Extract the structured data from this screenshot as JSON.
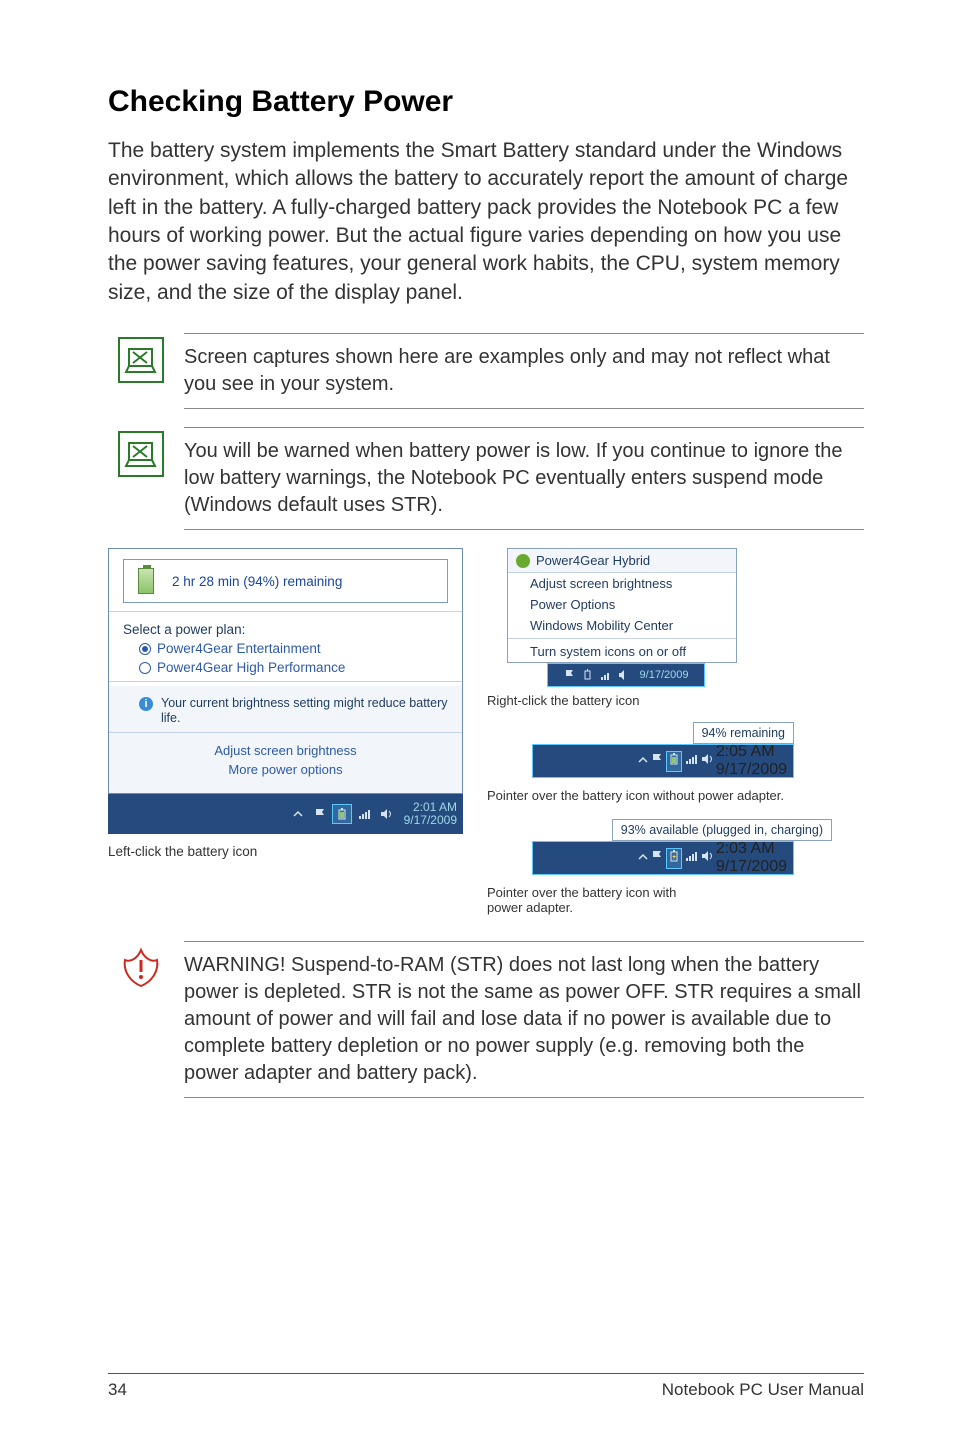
{
  "title": "Checking Battery Power",
  "intro": "The battery system implements the Smart Battery standard under the Windows environment, which allows the battery to accurately report the amount of charge left in the battery. A fully-charged battery pack provides the Notebook PC a few hours of working power. But the actual figure varies depending on how you use the power saving features, your general work habits, the CPU, system memory size, and the size of the display panel.",
  "note1": "Screen captures shown here are examples only and may not reflect what you see in your system.",
  "note2": "You will be warned when battery power is low. If you continue to ignore the low battery warnings, the Notebook PC eventually enters suspend mode (Windows default uses STR).",
  "left_panel": {
    "remaining": "2 hr 28 min (94%) remaining",
    "plan_header": "Select a power plan:",
    "plan1": "Power4Gear Entertainment",
    "plan2": "Power4Gear High Performance",
    "info": "Your current brightness setting might reduce battery life.",
    "link1": "Adjust screen brightness",
    "link2": "More power options",
    "clock_time": "2:01 AM",
    "clock_date": "9/17/2009",
    "caption": "Left-click the battery icon"
  },
  "right_panel": {
    "ctx_header": "Power4Gear Hybrid",
    "ctx_item1": "Adjust screen brightness",
    "ctx_item2": "Power Options",
    "ctx_item3": "Windows Mobility Center",
    "ctx_item4": "Turn system icons on or off",
    "ctx_date": "9/17/2009",
    "caption1": "Right-click the battery icon",
    "tooltip1": "94% remaining",
    "tray1_time": "2:05 AM",
    "tray1_date": "9/17/2009",
    "caption2": "Pointer over the battery icon without power adapter.",
    "tooltip2": "93% available (plugged in, charging)",
    "tray2_time": "2:03 AM",
    "tray2_date": "9/17/2009",
    "caption3_a": "Pointer over the battery icon with",
    "caption3_b": "power adapter."
  },
  "warning": "WARNING!  Suspend-to-RAM (STR) does not last long when the battery power is depleted. STR is not the same as power OFF. STR requires a small amount of power and will fail and lose data if no power is available due to complete battery depletion or no power supply (e.g. removing both the power adapter and battery pack).",
  "footer": {
    "page": "34",
    "label": "Notebook PC User Manual"
  }
}
